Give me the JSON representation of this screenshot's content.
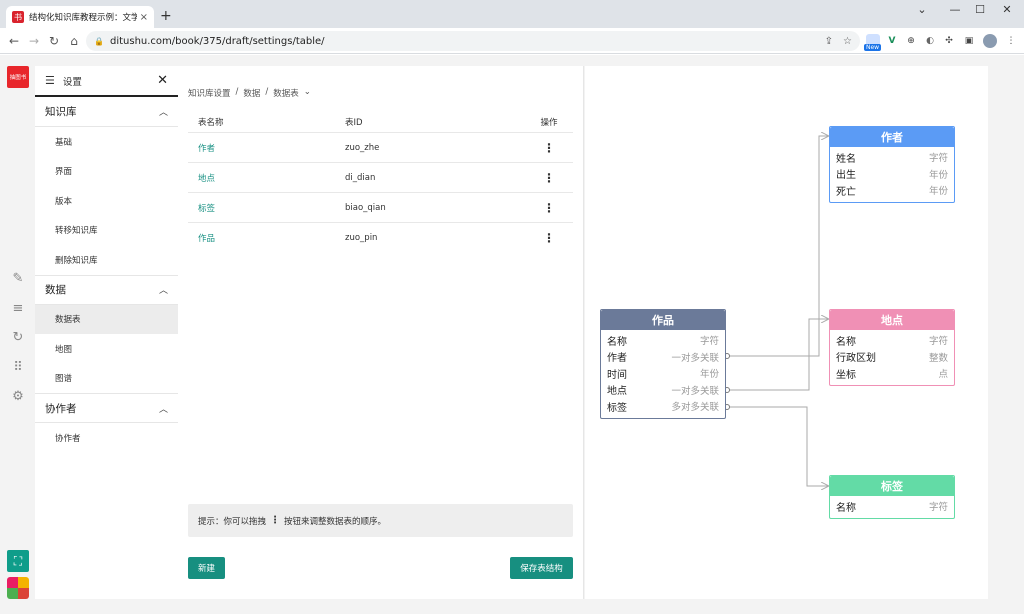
{
  "browser": {
    "tab_title": "结构化知识库教程示例：文学作",
    "tab_close": "×",
    "new_tab": "+",
    "url": "ditushu.com/book/375/draft/settings/table/",
    "new_badge": "New",
    "window_controls": [
      "⌄",
      "—",
      "☐",
      "✕"
    ],
    "nav": [
      "←",
      "→",
      "↻",
      "⌂"
    ]
  },
  "app": {
    "logo_text": "抽图书"
  },
  "settings": {
    "title": "设置",
    "sections": [
      {
        "label": "知识库",
        "items": [
          {
            "label": "基础"
          },
          {
            "label": "界面"
          },
          {
            "label": "版本"
          },
          {
            "label": "转移知识库"
          },
          {
            "label": "删除知识库"
          }
        ]
      },
      {
        "label": "数据",
        "items": [
          {
            "label": "数据表"
          },
          {
            "label": "地图"
          },
          {
            "label": "图谱"
          }
        ]
      },
      {
        "label": "协作者",
        "items": [
          {
            "label": "协作者"
          }
        ]
      }
    ]
  },
  "main": {
    "breadcrumb": [
      "知识库设置",
      "/",
      "数据",
      "/",
      "数据表",
      "⌄"
    ],
    "columns": [
      "表名称",
      "表ID",
      "操作"
    ],
    "rows": [
      {
        "name": "作者",
        "id": "zuo_zhe"
      },
      {
        "name": "地点",
        "id": "di_dian"
      },
      {
        "name": "标签",
        "id": "biao_qian"
      },
      {
        "name": "作品",
        "id": "zuo_pin"
      }
    ],
    "tip_prefix": "提示：你可以拖拽",
    "tip_suffix": "按钮来调整数据表的顺序。",
    "new_button": "新建",
    "save_button": "保存表结构"
  },
  "diagram": {
    "entities": [
      {
        "key": "zuopin",
        "title": "作品",
        "color": "#6b7a99",
        "fields": [
          {
            "name": "名称",
            "type": "字符"
          },
          {
            "name": "作者",
            "type": "一对多关联"
          },
          {
            "name": "时间",
            "type": "年份"
          },
          {
            "name": "地点",
            "type": "一对多关联"
          },
          {
            "name": "标签",
            "type": "多对多关联"
          }
        ]
      },
      {
        "key": "zuozhe",
        "title": "作者",
        "color": "#5b9bf5",
        "fields": [
          {
            "name": "姓名",
            "type": "字符"
          },
          {
            "name": "出生",
            "type": "年份"
          },
          {
            "name": "死亡",
            "type": "年份"
          }
        ]
      },
      {
        "key": "didian",
        "title": "地点",
        "color": "#f090b5",
        "fields": [
          {
            "name": "名称",
            "type": "字符"
          },
          {
            "name": "行政区划",
            "type": "整数"
          },
          {
            "name": "坐标",
            "type": "点"
          }
        ]
      },
      {
        "key": "biaoqian",
        "title": "标签",
        "color": "#63dba6",
        "fields": [
          {
            "name": "名称",
            "type": "字符"
          }
        ]
      }
    ]
  }
}
